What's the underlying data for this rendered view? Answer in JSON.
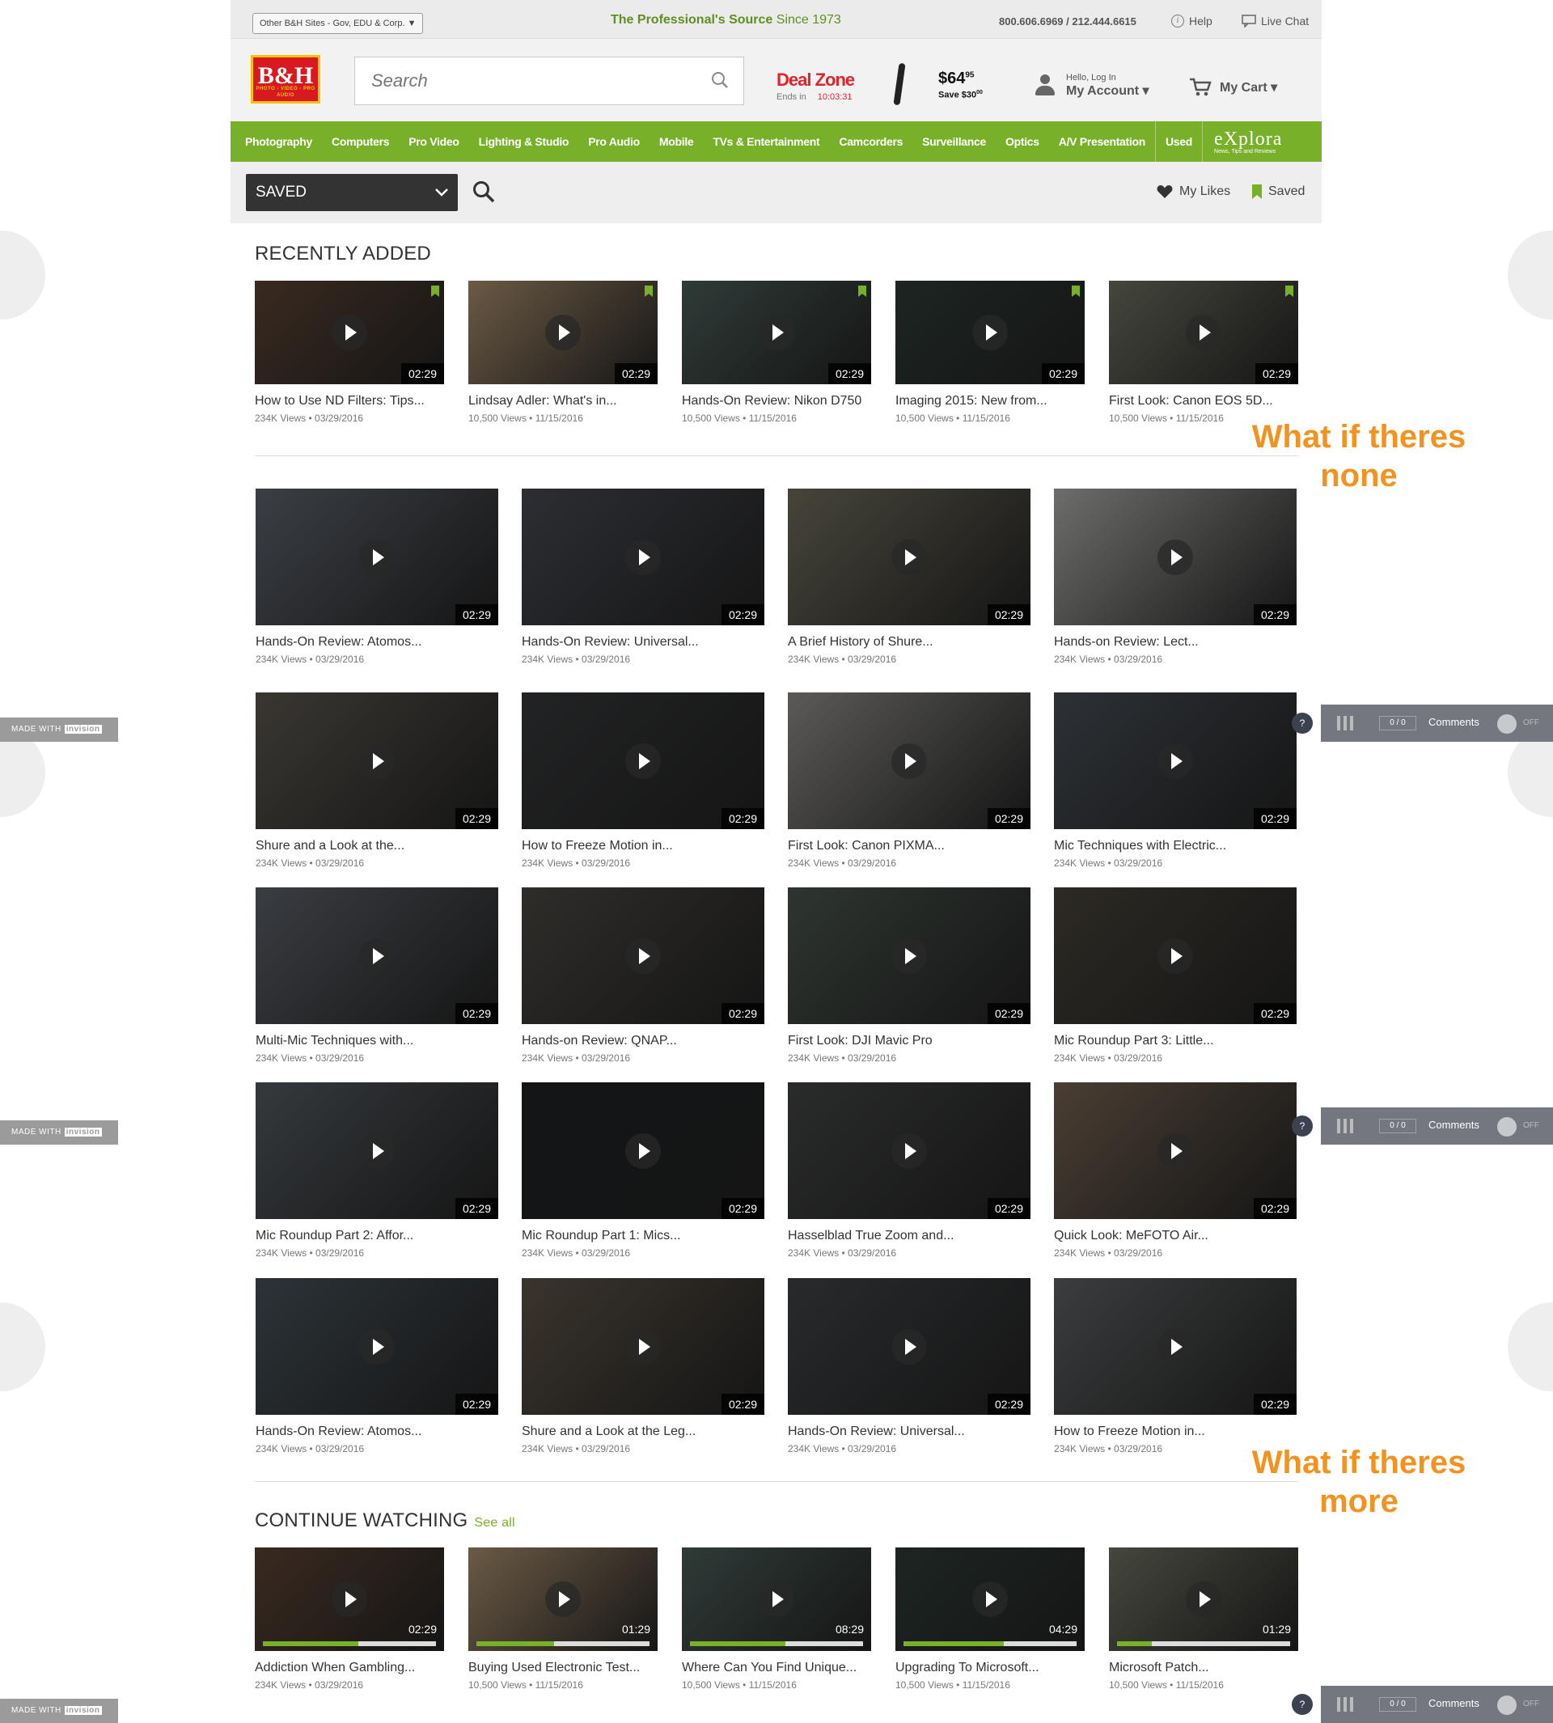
{
  "topbar": {
    "other_sites": "Other B&H Sites - Gov, EDU & Corp. ▼",
    "tagline": "The Professional's Source",
    "since": "Since 1973",
    "phone": "800.606.6969 / 212.444.6615",
    "help": "Help",
    "live_chat": "Live Chat"
  },
  "header": {
    "logo": "B&H",
    "logo_sub": "PHOTO - VIDEO - PRO AUDIO",
    "search_placeholder": "Search",
    "deal_zone": "Deal Zone",
    "ends_in": "Ends in",
    "countdown": "10:03:31",
    "deal_price": "$64",
    "deal_cents": "95",
    "deal_save": "Save $30",
    "deal_save_cents": "00",
    "account_hello": "Hello, Log In",
    "account_label": "My Account ▾",
    "cart_label": "My Cart ▾"
  },
  "nav": {
    "items": [
      "Photography",
      "Computers",
      "Pro Video",
      "Lighting & Studio",
      "Pro Audio",
      "Mobile",
      "TVs & Entertainment",
      "Camcorders",
      "Surveillance",
      "Optics",
      "A/V Presentation"
    ],
    "used": "Used",
    "explora": "eXplora",
    "explora_sub": "News, Tips and Reviews"
  },
  "savedbar": {
    "dropdown_value": "SAVED",
    "my_likes": "My Likes",
    "saved": "Saved"
  },
  "recent": {
    "title": "RECENTLY ADDED",
    "items": [
      {
        "title": "How to Use ND Filters: Tips...",
        "meta": "234K Views • 03/29/2016",
        "duration": "02:29",
        "color": "#3a2a20"
      },
      {
        "title": "Lindsay Adler: What's in...",
        "meta": "10,500 Views • 11/15/2016",
        "duration": "02:29",
        "color": "#6b5a45"
      },
      {
        "title": "Hands-On Review: Nikon D750",
        "meta": "10,500 Views • 11/15/2016",
        "duration": "02:29",
        "color": "#2f3b38"
      },
      {
        "title": "Imaging 2015: New from...",
        "meta": "10,500 Views • 11/15/2016",
        "duration": "02:29",
        "color": "#1d2523"
      },
      {
        "title": "First Look: Canon EOS 5D...",
        "meta": "10,500 Views • 11/15/2016",
        "duration": "02:29",
        "color": "#45473d"
      }
    ]
  },
  "grid": {
    "items": [
      {
        "title": "Hands-On Review: Atomos...",
        "meta": "234K Views • 03/29/2016",
        "duration": "02:29",
        "color": "#3b3f45"
      },
      {
        "title": "Hands-On Review: Universal...",
        "meta": "234K Views • 03/29/2016",
        "duration": "02:29",
        "color": "#2c2e33"
      },
      {
        "title": "A Brief History of Shure...",
        "meta": "234K Views • 03/29/2016",
        "duration": "02:29",
        "color": "#47453a"
      },
      {
        "title": "Hands-on Review: Lect...",
        "meta": "234K Views • 03/29/2016",
        "duration": "02:29",
        "color": "#6d6d6b"
      },
      {
        "title": "Shure and a Look at the...",
        "meta": "234K Views • 03/29/2016",
        "duration": "02:29",
        "color": "#3a3732"
      },
      {
        "title": "How to Freeze Motion in...",
        "meta": "234K Views • 03/29/2016",
        "duration": "02:29",
        "color": "#222324"
      },
      {
        "title": "First Look: Canon PIXMA...",
        "meta": "234K Views • 03/29/2016",
        "duration": "02:29",
        "color": "#5b5a58"
      },
      {
        "title": "Mic Techniques with Electric...",
        "meta": "234K Views • 03/29/2016",
        "duration": "02:29",
        "color": "#2d3136"
      },
      {
        "title": "Multi-Mic Techniques with...",
        "meta": "234K Views • 03/29/2016",
        "duration": "02:29",
        "color": "#3a3d42"
      },
      {
        "title": "Hands-on Review: QNAP...",
        "meta": "234K Views • 03/29/2016",
        "duration": "02:29",
        "color": "#2f2d2a"
      },
      {
        "title": "First Look: DJI Mavic Pro",
        "meta": "234K Views • 03/29/2016",
        "duration": "02:29",
        "color": "#2e3530"
      },
      {
        "title": "Mic Roundup Part 3: Little...",
        "meta": "234K Views • 03/29/2016",
        "duration": "02:29",
        "color": "#2d2a24"
      },
      {
        "title": "Mic Roundup Part 2: Affor...",
        "meta": "234K Views • 03/29/2016",
        "duration": "02:29",
        "color": "#35393d"
      },
      {
        "title": "Mic Roundup Part 1: Mics...",
        "meta": "234K Views • 03/29/2016",
        "duration": "02:29",
        "color": "#131516"
      },
      {
        "title": "Hasselblad True Zoom and...",
        "meta": "234K Views • 03/29/2016",
        "duration": "02:29",
        "color": "#2a2b2b"
      },
      {
        "title": "Quick Look: MeFOTO Air...",
        "meta": "234K Views • 03/29/2016",
        "duration": "02:29",
        "color": "#4a3e33"
      },
      {
        "title": "Hands-On Review: Atomos...",
        "meta": "234K Views • 03/29/2016",
        "duration": "02:29",
        "color": "#2c3338"
      },
      {
        "title": "Shure and a Look at the Leg...",
        "meta": "234K Views • 03/29/2016",
        "duration": "02:29",
        "color": "#3a342c"
      },
      {
        "title": "Hands-On Review: Universal...",
        "meta": "234K Views • 03/29/2016",
        "duration": "02:29",
        "color": "#282a2c"
      },
      {
        "title": "How to Freeze Motion in...",
        "meta": "234K Views • 03/29/2016",
        "duration": "02:29",
        "color": "#3b3d3e"
      }
    ]
  },
  "continue": {
    "title": "CONTINUE WATCHING",
    "see_all": "See all",
    "items": [
      {
        "title": "Addiction When Gambling...",
        "meta": "234K Views • 03/29/2016",
        "duration": "02:29",
        "progress": 0.55,
        "color": "#3a2a20"
      },
      {
        "title": "Buying Used Electronic Test...",
        "meta": "10,500 Views • 11/15/2016",
        "duration": "01:29",
        "progress": 0.45,
        "color": "#6b5a45"
      },
      {
        "title": "Where Can You Find Unique...",
        "meta": "10,500 Views • 11/15/2016",
        "duration": "08:29",
        "progress": 0.55,
        "color": "#2f3b38"
      },
      {
        "title": "Upgrading To Microsoft...",
        "meta": "10,500 Views • 11/15/2016",
        "duration": "04:29",
        "progress": 0.58,
        "color": "#1d2523"
      },
      {
        "title": "Microsoft Patch...",
        "meta": "10,500 Views • 11/15/2016",
        "duration": "01:29",
        "progress": 0.2,
        "color": "#45473d"
      }
    ]
  },
  "notes": {
    "none": "What if theres none",
    "more": "What if theres more"
  },
  "invision": {
    "made_with": "MADE WITH",
    "brand": "invision",
    "count": "0 / 0",
    "comments": "Comments",
    "off": "OFF",
    "help": "?"
  },
  "colors": {
    "accent": "#78b029",
    "annotation": "#f29320"
  }
}
